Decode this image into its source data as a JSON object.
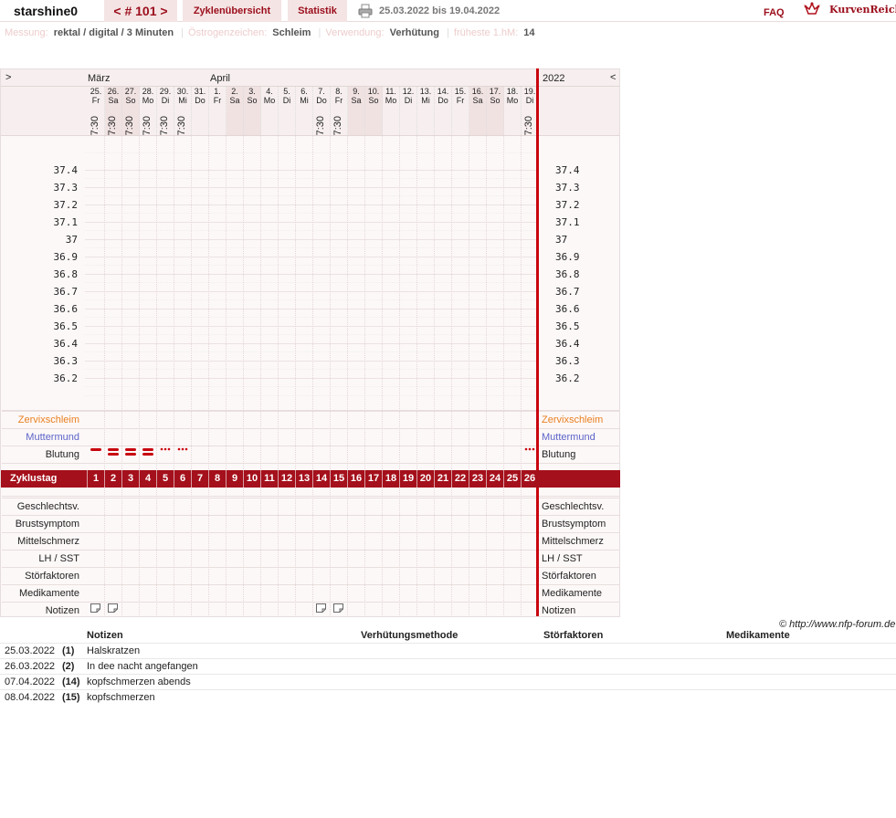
{
  "topbar": {
    "user": "starshine0",
    "cycle_nav": "< # 101 >",
    "tab_overview": "Zyklenübersicht",
    "tab_stats": "Statistik",
    "date_range": "25.03.2022 bis 19.04.2022",
    "faq": "FAQ",
    "logo_text": "KurvenReich"
  },
  "info": {
    "measure_label": "Messung:",
    "measure_value": "rektal / digital / 3 Minuten",
    "estrogen_label": "Östrogenzeichen:",
    "estrogen_value": "Schleim",
    "usage_label": "Verwendung:",
    "usage_value": "Verhütung",
    "earliest_label": "früheste 1.hM:",
    "earliest_value": "14"
  },
  "chart": {
    "nav_prev": ">",
    "nav_next": "<",
    "month_1": "März",
    "month_2": "April",
    "year": "2022",
    "days": [
      {
        "d": "25.",
        "w": "Fr",
        "t": "7:30",
        "we": false
      },
      {
        "d": "26.",
        "w": "Sa",
        "t": "7:30",
        "we": true
      },
      {
        "d": "27.",
        "w": "So",
        "t": "7:30",
        "we": true
      },
      {
        "d": "28.",
        "w": "Mo",
        "t": "7:30",
        "we": false
      },
      {
        "d": "29.",
        "w": "Di",
        "t": "7:30",
        "we": false
      },
      {
        "d": "30.",
        "w": "Mi",
        "t": "7:30",
        "we": false
      },
      {
        "d": "31.",
        "w": "Do",
        "t": "",
        "we": false
      },
      {
        "d": "1.",
        "w": "Fr",
        "t": "",
        "we": false
      },
      {
        "d": "2.",
        "w": "Sa",
        "t": "",
        "we": true
      },
      {
        "d": "3.",
        "w": "So",
        "t": "",
        "we": true
      },
      {
        "d": "4.",
        "w": "Mo",
        "t": "",
        "we": false
      },
      {
        "d": "5.",
        "w": "Di",
        "t": "",
        "we": false
      },
      {
        "d": "6.",
        "w": "Mi",
        "t": "",
        "we": false
      },
      {
        "d": "7.",
        "w": "Do",
        "t": "7:30",
        "we": false
      },
      {
        "d": "8.",
        "w": "Fr",
        "t": "7:30",
        "we": false
      },
      {
        "d": "9.",
        "w": "Sa",
        "t": "",
        "we": true
      },
      {
        "d": "10.",
        "w": "So",
        "t": "",
        "we": true
      },
      {
        "d": "11.",
        "w": "Mo",
        "t": "",
        "we": false
      },
      {
        "d": "12.",
        "w": "Di",
        "t": "",
        "we": false
      },
      {
        "d": "13.",
        "w": "Mi",
        "t": "",
        "we": false
      },
      {
        "d": "14.",
        "w": "Do",
        "t": "",
        "we": false
      },
      {
        "d": "15.",
        "w": "Fr",
        "t": "",
        "we": false
      },
      {
        "d": "16.",
        "w": "Sa",
        "t": "",
        "we": true
      },
      {
        "d": "17.",
        "w": "So",
        "t": "",
        "we": true
      },
      {
        "d": "18.",
        "w": "Mo",
        "t": "",
        "we": false
      },
      {
        "d": "19.",
        "w": "Di",
        "t": "7:30",
        "we": false
      }
    ],
    "temps": [
      "37.4",
      "37.3",
      "37.2",
      "37.1",
      "37",
      "36.9",
      "36.8",
      "36.7",
      "36.6",
      "36.5",
      "36.4",
      "36.3",
      "36.2"
    ],
    "row_zervix": "Zervixschleim",
    "row_muttermund": "Muttermund",
    "row_blutung": "Blutung",
    "zyklustag_label": "Zyklustag",
    "bleeding": [
      "dash",
      "heavy",
      "heavy",
      "heavy",
      "dots",
      "dots",
      "",
      "",
      "",
      "",
      "",
      "",
      "",
      "",
      "",
      "",
      "",
      "",
      "",
      "",
      "",
      "",
      "",
      "",
      "",
      "dots"
    ],
    "lower_rows": [
      "Geschlechtsv.",
      "Brustsymptom",
      "Mittelschmerz",
      "LH / SST",
      "Störfaktoren",
      "Medikamente",
      "Notizen"
    ],
    "notes_days": [
      1,
      2,
      14,
      15
    ]
  },
  "copyright": "© http://www.nfp-forum.de",
  "notes": {
    "headers": {
      "notes": "Notizen",
      "method": "Verhütungsmethode",
      "disturb": "Störfaktoren",
      "meds": "Medikamente"
    },
    "rows": [
      {
        "date": "25.03.2022",
        "day": "(1)",
        "text": "Halskratzen"
      },
      {
        "date": "26.03.2022",
        "day": "(2)",
        "text": "In dee nacht angefangen"
      },
      {
        "date": "07.04.2022",
        "day": "(14)",
        "text": "kopfschmerzen abends"
      },
      {
        "date": "08.04.2022",
        "day": "(15)",
        "text": "kopfschmerzen"
      }
    ]
  }
}
